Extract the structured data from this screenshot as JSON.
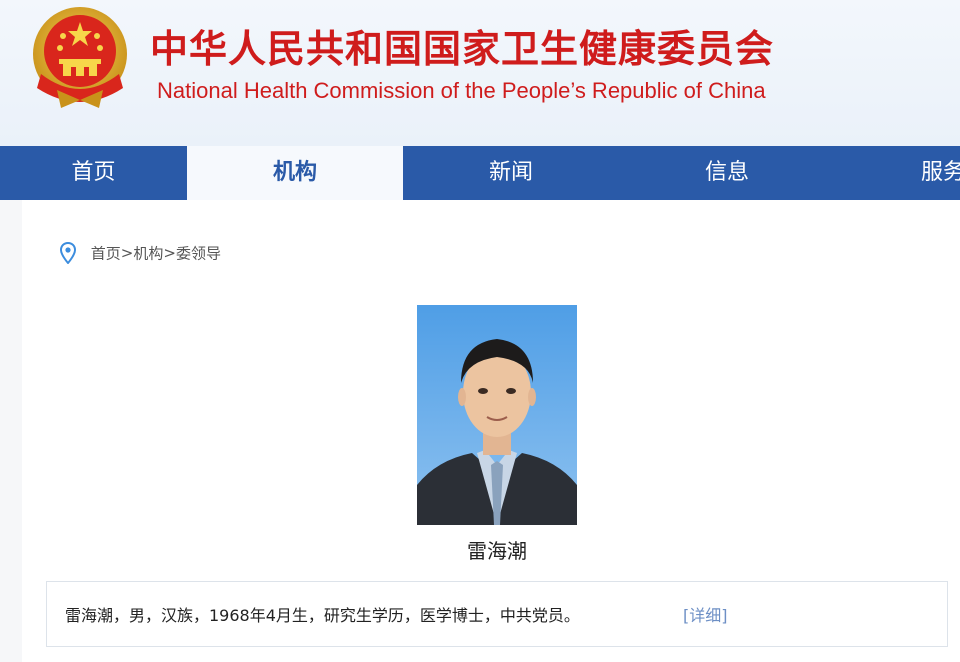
{
  "header": {
    "title_cn": "中华人民共和国国家卫生健康委员会",
    "title_en": "National Health Commission of the People’s  Republic of China"
  },
  "nav": {
    "items": [
      {
        "label": "首页"
      },
      {
        "label": "机构"
      },
      {
        "label": "新闻"
      },
      {
        "label": "信息"
      },
      {
        "label": "服务"
      }
    ],
    "active": "机构"
  },
  "breadcrumb": {
    "items": [
      "首页",
      "机构",
      "委领导"
    ],
    "separator": ">"
  },
  "profile": {
    "name": "雷海潮",
    "bio": "雷海潮，男，汉族，1968年4月生，研究生学历，医学博士，中共党员。",
    "more_link": "[详细]"
  },
  "colors": {
    "brand_red": "#cf1c1c",
    "nav_blue": "#2a5aa8",
    "link_blue": "#6d8fc5"
  }
}
